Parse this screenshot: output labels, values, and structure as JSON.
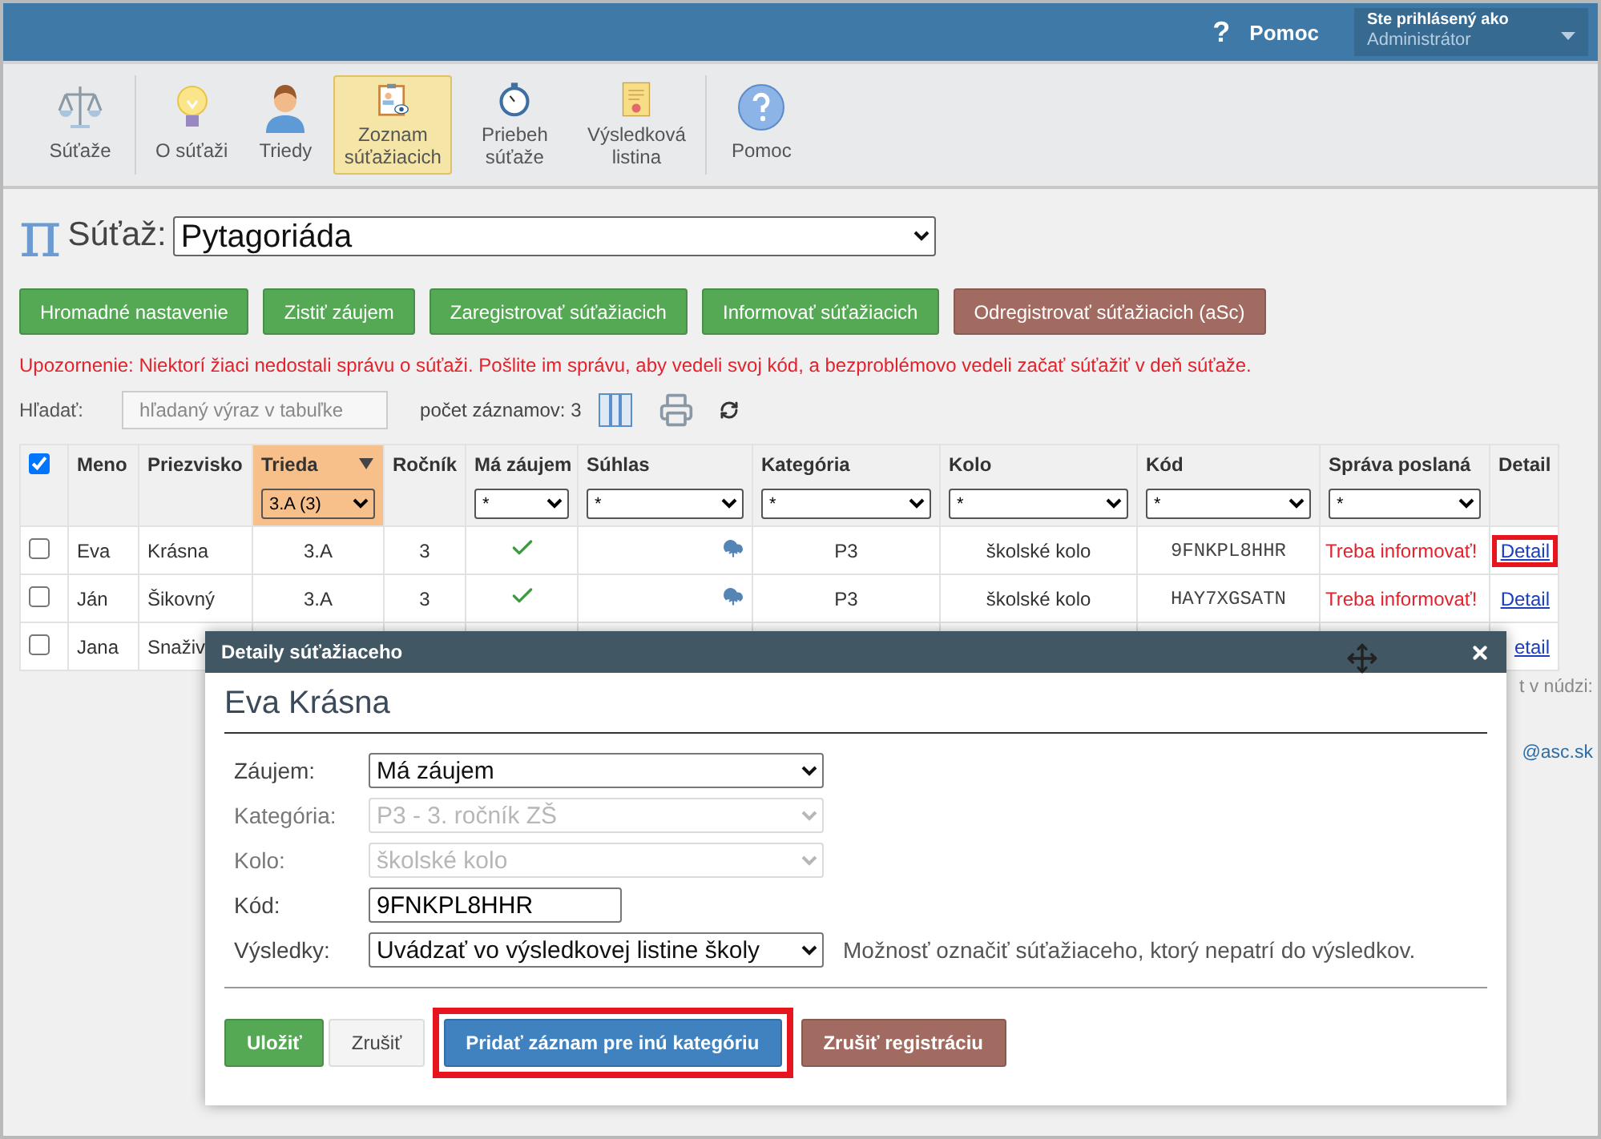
{
  "header": {
    "help_icon": "?",
    "help": "Pomoc",
    "user_label": "Ste prihlásený ako",
    "user": "Administrátor"
  },
  "toolbar": [
    [
      {
        "label": "Súťaže",
        "kind": "scales",
        "selected": false
      }
    ],
    [
      {
        "label": "O súťaži",
        "kind": "bulb",
        "selected": false
      },
      {
        "label": "Triedy",
        "kind": "person",
        "selected": false
      },
      {
        "label": "Zoznam súťažiacich",
        "kind": "clipboard",
        "selected": true
      },
      {
        "label": "Priebeh súťaže",
        "kind": "stopwatch",
        "selected": false
      },
      {
        "label": "Výsledková listina",
        "kind": "certificate",
        "selected": false
      }
    ],
    [
      {
        "label": "Pomoc",
        "kind": "help",
        "selected": false
      }
    ]
  ],
  "competition": {
    "logo": "π",
    "label": "Súťaž:",
    "value": "Pytagoriáda"
  },
  "actions": [
    {
      "label": "Hromadné nastavenie",
      "kind": "success"
    },
    {
      "label": "Zistiť záujem",
      "kind": "success"
    },
    {
      "label": "Zaregistrovať súťažiacich",
      "kind": "success"
    },
    {
      "label": "Informovať súťažiacich",
      "kind": "success"
    },
    {
      "label": "Odregistrovať súťažiacich (aSc)",
      "kind": "danger"
    }
  ],
  "warning": "Upozornenie: Niektorí žiaci nedostali správu o súťaži. Pošlite im správu, aby vedeli svoj kód, a bezproblémovo vedeli začať súťažiť v deň súťaže.",
  "search": {
    "label": "Hľadať:",
    "placeholder": "hľadaný výraz v tabuľke",
    "count": "počet záznamov: 3"
  },
  "table": {
    "all_checked": true,
    "columns": [
      {
        "label": "Meno"
      },
      {
        "label": "Priezvisko"
      },
      {
        "label": "Trieda",
        "sorted": true,
        "filter": "3.A (3)",
        "filter_active": true
      },
      {
        "label": "Ročník"
      },
      {
        "label": "Má záujem",
        "filter": "*",
        "filter_active": false
      },
      {
        "label": "Súhlas",
        "filter": "*",
        "filter_active": false
      },
      {
        "label": "Kategória",
        "filter": "*",
        "filter_active": false
      },
      {
        "label": "Kolo",
        "filter": "*",
        "filter_active": false
      },
      {
        "label": "Kód",
        "filter": "*",
        "filter_active": false
      },
      {
        "label": "Správa poslaná",
        "filter": "*",
        "filter_active": false
      },
      {
        "label": "Detail"
      }
    ],
    "rows": [
      {
        "checked": false,
        "first_name": "Eva",
        "last_name": "Krásna",
        "class": "3.A",
        "grade": "3",
        "interested": true,
        "consent": true,
        "category": "P3",
        "round": "školské kolo",
        "code": "9FNKPL8HHR",
        "message": "Treba informovať!",
        "detail": "Detail",
        "highlighted": true
      },
      {
        "checked": false,
        "first_name": "Ján",
        "last_name": "Šikovný",
        "class": "3.A",
        "grade": "3",
        "interested": true,
        "consent": true,
        "category": "P3",
        "round": "školské kolo",
        "code": "HAY7XGSATN",
        "message": "Treba informovať!",
        "detail": "Detail",
        "highlighted": false
      },
      {
        "checked": false,
        "first_name": "Jana",
        "last_name": "Snaživ",
        "detail": "etail",
        "highlighted": false
      }
    ]
  },
  "side_note": [
    "t v núdzi:",
    "@asc.sk"
  ],
  "dialog": {
    "title": "Detaily súťažiaceho",
    "name": "Eva Krásna",
    "fields": [
      {
        "label": "Záujem:",
        "kind": "select",
        "value": "Má záujem",
        "disabled": false
      },
      {
        "label": "Kategória:",
        "kind": "select",
        "value": "P3 - 3. ročník ZŠ",
        "disabled": true
      },
      {
        "label": "Kolo:",
        "kind": "select",
        "value": "školské kolo",
        "disabled": true
      },
      {
        "label": "Kód:",
        "kind": "text",
        "value": "9FNKPL8HHR",
        "disabled": false
      },
      {
        "label": "Výsledky:",
        "kind": "select",
        "value": "Uvádzať vo výsledkovej listine školy",
        "disabled": false,
        "note": "Možnosť označiť súťažiaceho, ktorý nepatrí do výsledkov."
      }
    ],
    "buttons": [
      {
        "label": "Uložiť",
        "kind": "success",
        "highlighted": false
      },
      {
        "label": "Zrušiť",
        "kind": "default",
        "highlighted": false
      },
      {
        "label": "Pridať záznam pre inú kategóriu",
        "kind": "primary",
        "highlighted": true
      },
      {
        "label": "Zrušiť registráciu",
        "kind": "danger",
        "highlighted": false
      }
    ]
  }
}
